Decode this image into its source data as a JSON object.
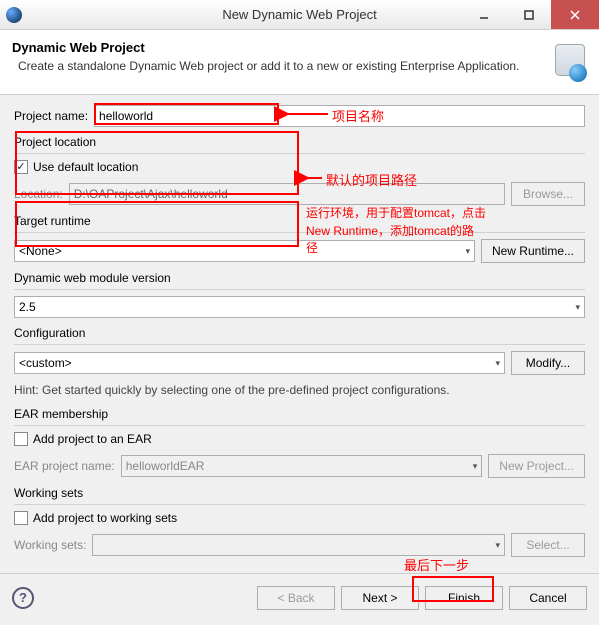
{
  "window": {
    "title": "New Dynamic Web Project"
  },
  "banner": {
    "title": "Dynamic Web Project",
    "desc": "Create a standalone Dynamic Web project or add it to a new or existing Enterprise Application."
  },
  "projectName": {
    "label": "Project name:",
    "value": "helloworld"
  },
  "location": {
    "group": "Project location",
    "useDefault": "Use default location",
    "label": "Location:",
    "value": "D:\\OAProject\\Ajax\\helloworld",
    "browse": "Browse..."
  },
  "runtime": {
    "group": "Target runtime",
    "value": "<None>",
    "newRuntime": "New Runtime..."
  },
  "module": {
    "group": "Dynamic web module version",
    "value": "2.5"
  },
  "config": {
    "group": "Configuration",
    "value": "<custom>",
    "modify": "Modify...",
    "hint": "Hint: Get started quickly by selecting one of the pre-defined project configurations."
  },
  "ear": {
    "group": "EAR membership",
    "add": "Add project to an EAR",
    "label": "EAR project name:",
    "value": "helloworldEAR",
    "newProject": "New Project..."
  },
  "ws": {
    "group": "Working sets",
    "add": "Add project to working sets",
    "label": "Working sets:",
    "select": "Select..."
  },
  "footer": {
    "back": "< Back",
    "next": "Next >",
    "finish": "Finish",
    "cancel": "Cancel"
  },
  "annotations": {
    "name": "项目名称",
    "path": "默认的项目路径",
    "runtime": "运行环境，用于配置tomcat，点击New Runtime，添加tomcat的路径",
    "finish": "最后下一步"
  }
}
